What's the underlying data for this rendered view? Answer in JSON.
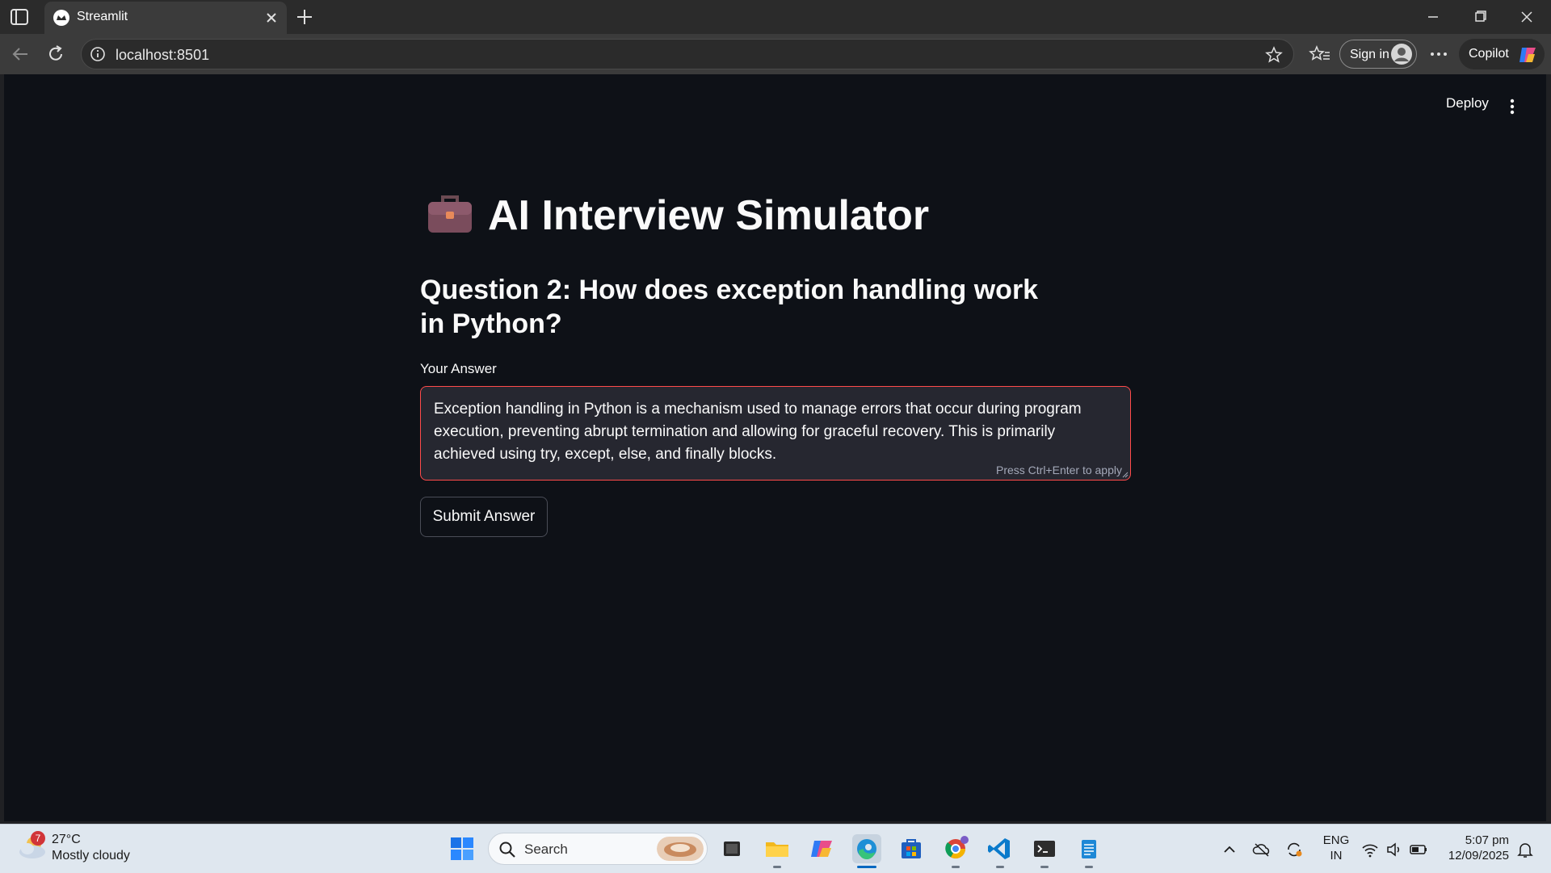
{
  "browser": {
    "tab_title": "Streamlit",
    "url": "localhost:8501",
    "sign_in_label": "Sign in",
    "copilot_label": "Copilot"
  },
  "app": {
    "deploy_label": "Deploy",
    "title_icon": "briefcase-icon",
    "title": "AI Interview Simulator",
    "question": "Question 2: How does exception handling work in Python?",
    "answer_label": "Your Answer",
    "answer_value": "Exception handling in Python is a mechanism used to manage errors that occur during program execution, preventing abrupt termination and allowing for graceful recovery. This is primarily achieved using try, except, else, and finally blocks.",
    "answer_hint": "Press Ctrl+Enter to apply",
    "submit_label": "Submit Answer",
    "colors": {
      "background": "#0e1117",
      "text": "#fafafa",
      "input_bg": "#262730",
      "focus_border": "#ff4b4b"
    }
  },
  "taskbar": {
    "weather_badge": "7",
    "weather_temp": "27°C",
    "weather_desc": "Mostly cloudy",
    "search_label": "Search",
    "lang_line1": "ENG",
    "lang_line2": "IN",
    "time": "5:07 pm",
    "date": "12/09/2025",
    "apps": [
      "task-view-icon",
      "file-explorer-icon",
      "copilot-app-icon",
      "edge-icon",
      "store-icon",
      "chrome-icon",
      "vscode-icon",
      "terminal-icon",
      "notepad-icon"
    ]
  }
}
